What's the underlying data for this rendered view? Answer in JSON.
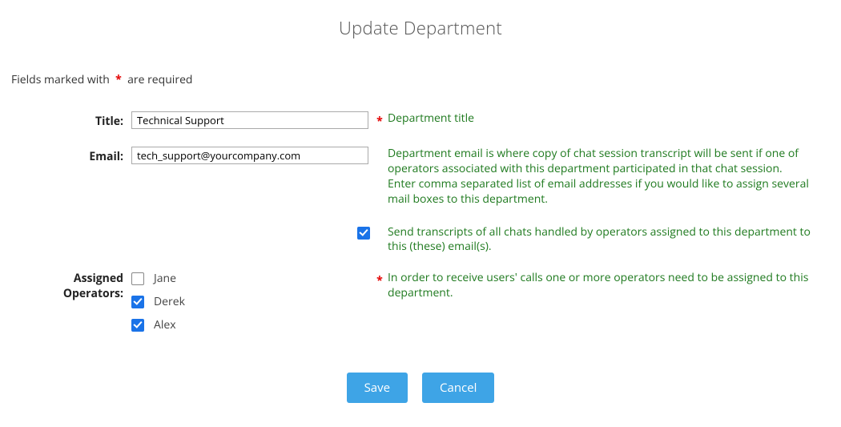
{
  "page_title": "Update Department",
  "required_note": {
    "prefix": "Fields marked with",
    "asterisk": "*",
    "suffix": "are required"
  },
  "fields": {
    "title": {
      "label": "Title:",
      "value": "Technical Support",
      "required_mark": "*",
      "hint": "Department title"
    },
    "email": {
      "label": "Email:",
      "value": "tech_support@yourcompany.com",
      "hint": "Department email is where copy of chat session transcript will be sent if one of operators associated with this department participated in that chat session.\nEnter comma separated list of email addresses if you would like to assign several mail boxes to this department."
    },
    "send_transcripts": {
      "checked": true,
      "hint": "Send transcripts of all chats handled by operators assigned to this department to this (these) email(s)."
    },
    "operators": {
      "label": "Assigned Operators:",
      "required_mark": "*",
      "hint": "In order to receive users' calls one or more operators need to be assigned to this department.",
      "items": [
        {
          "name": "Jane",
          "checked": false
        },
        {
          "name": "Derek",
          "checked": true
        },
        {
          "name": "Alex",
          "checked": true
        }
      ]
    }
  },
  "buttons": {
    "save": "Save",
    "cancel": "Cancel"
  }
}
